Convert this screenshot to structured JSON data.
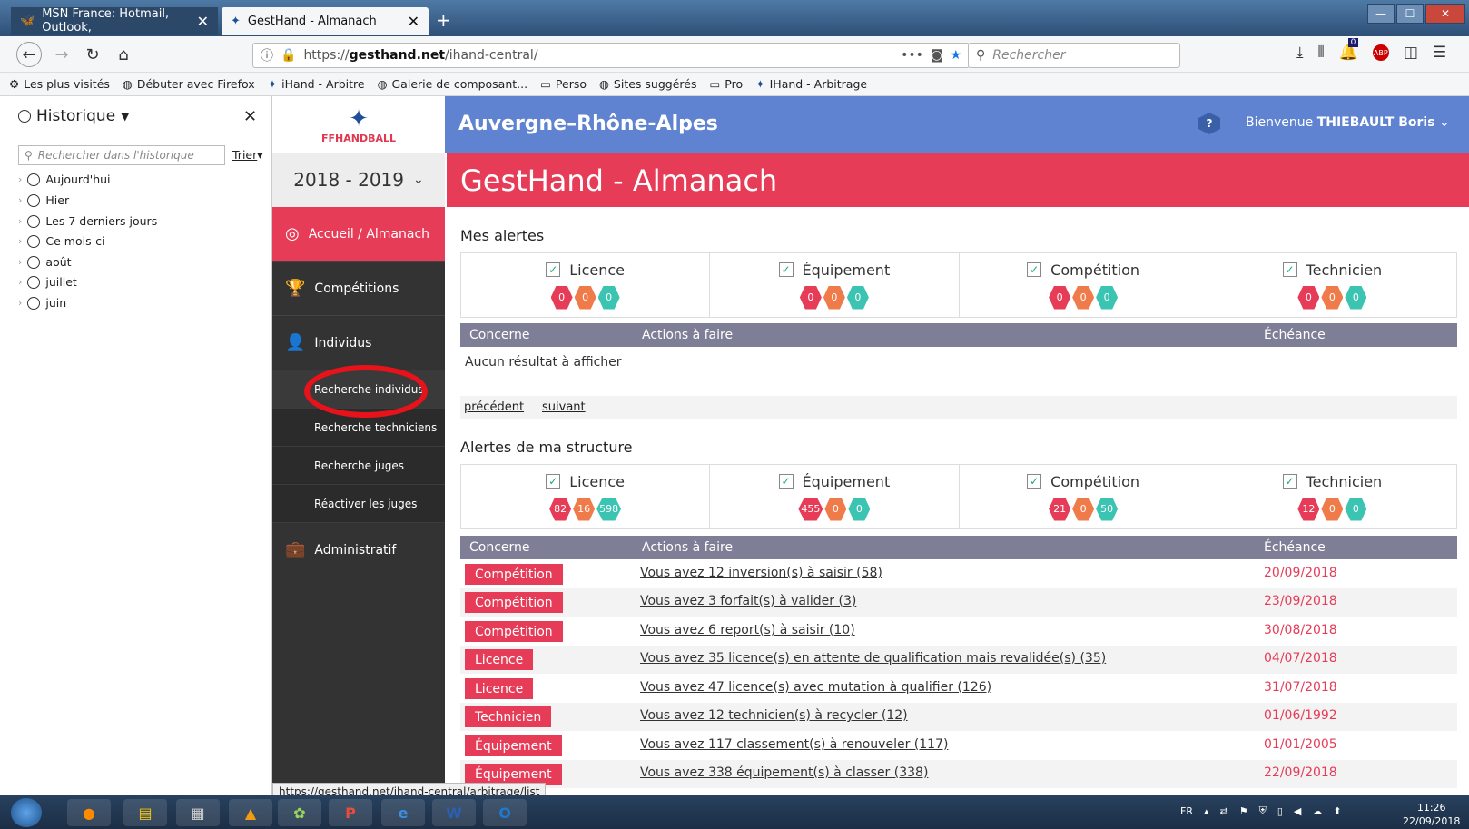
{
  "browser": {
    "tabs": [
      {
        "label": "MSN France: Hotmail, Outlook,"
      },
      {
        "label": "GestHand - Almanach"
      }
    ],
    "url_prefix": "https://",
    "url_domain": "gesthand.net",
    "url_path": "/ihand-central/",
    "search_placeholder": "Rechercher",
    "bookmarks": [
      "Les plus visités",
      "Débuter avec Firefox",
      "iHand - Arbitre",
      "Galerie de composant...",
      "Perso",
      "Sites suggérés",
      "Pro",
      "IHand - Arbitrage"
    ],
    "status_url": "https://gesthand.net/ihand-central/arbitrage/list",
    "badge_count": "0"
  },
  "history": {
    "title": "Historique",
    "search_placeholder": "Rechercher dans l'historique",
    "sort": "Trier",
    "items": [
      "Aujourd'hui",
      "Hier",
      "Les 7 derniers jours",
      "Ce mois-ci",
      "août",
      "juillet",
      "juin"
    ]
  },
  "app": {
    "logo_text": "FFHANDBALL",
    "region": "Auvergne–Rhône-Alpes",
    "help": "?",
    "welcome_prefix": "Bienvenue ",
    "welcome_user": "THIEBAULT Boris",
    "season": "2018 - 2019",
    "nav": {
      "home": "Accueil / Almanach",
      "competitions": "Compétitions",
      "individus": "Individus",
      "admin": "Administratif"
    },
    "subnav": [
      "Recherche individus",
      "Recherche techniciens",
      "Recherche juges",
      "Réactiver les juges"
    ],
    "page_title": "GestHand - Almanach"
  },
  "mes_alertes": {
    "title": "Mes alertes",
    "cells": [
      {
        "label": "Licence",
        "counts": [
          "0",
          "0",
          "0"
        ]
      },
      {
        "label": "Équipement",
        "counts": [
          "0",
          "0",
          "0"
        ]
      },
      {
        "label": "Compétition",
        "counts": [
          "0",
          "0",
          "0"
        ]
      },
      {
        "label": "Technicien",
        "counts": [
          "0",
          "0",
          "0"
        ]
      }
    ],
    "headers": {
      "concerne": "Concerne",
      "actions": "Actions à faire",
      "echeance": "Échéance"
    },
    "empty": "Aucun résultat à afficher",
    "prev": "précédent",
    "next": "suivant"
  },
  "structure": {
    "title": "Alertes de ma structure",
    "cells": [
      {
        "label": "Licence",
        "counts": [
          "82",
          "16",
          "598"
        ]
      },
      {
        "label": "Équipement",
        "counts": [
          "455",
          "0",
          "0"
        ]
      },
      {
        "label": "Compétition",
        "counts": [
          "21",
          "0",
          "50"
        ]
      },
      {
        "label": "Technicien",
        "counts": [
          "12",
          "0",
          "0"
        ]
      }
    ],
    "headers": {
      "concerne": "Concerne",
      "actions": "Actions à faire",
      "echeance": "Échéance"
    },
    "rows": [
      {
        "type": "Compétition",
        "action": "Vous avez 12 inversion(s) à saisir (58)",
        "date": "20/09/2018"
      },
      {
        "type": "Compétition",
        "action": "Vous avez 3 forfait(s) à valider (3)",
        "date": "23/09/2018"
      },
      {
        "type": "Compétition",
        "action": "Vous avez 6 report(s) à saisir (10)",
        "date": "30/08/2018"
      },
      {
        "type": "Licence",
        "action": "Vous avez 35 licence(s) en attente de qualification mais revalidée(s) (35)",
        "date": "04/07/2018"
      },
      {
        "type": "Licence",
        "action": "Vous avez 47 licence(s) avec mutation à qualifier (126)",
        "date": "31/07/2018"
      },
      {
        "type": "Technicien",
        "action": "Vous avez 12 technicien(s) à recycler (12)",
        "date": "01/06/1992"
      },
      {
        "type": "Équipement",
        "action": "Vous avez 117 classement(s) à renouveler (117)",
        "date": "01/01/2005"
      },
      {
        "type": "Équipement",
        "action": "Vous avez 338 équipement(s) à classer (338)",
        "date": "22/09/2018"
      }
    ]
  },
  "taskbar": {
    "lang": "FR",
    "time": "11:26",
    "date": "22/09/2018"
  },
  "colors": {
    "header_blue": "#5f83d1",
    "accent_red": "#e63c57",
    "nav_dark": "#333333",
    "table_head": "#7e7e96"
  }
}
